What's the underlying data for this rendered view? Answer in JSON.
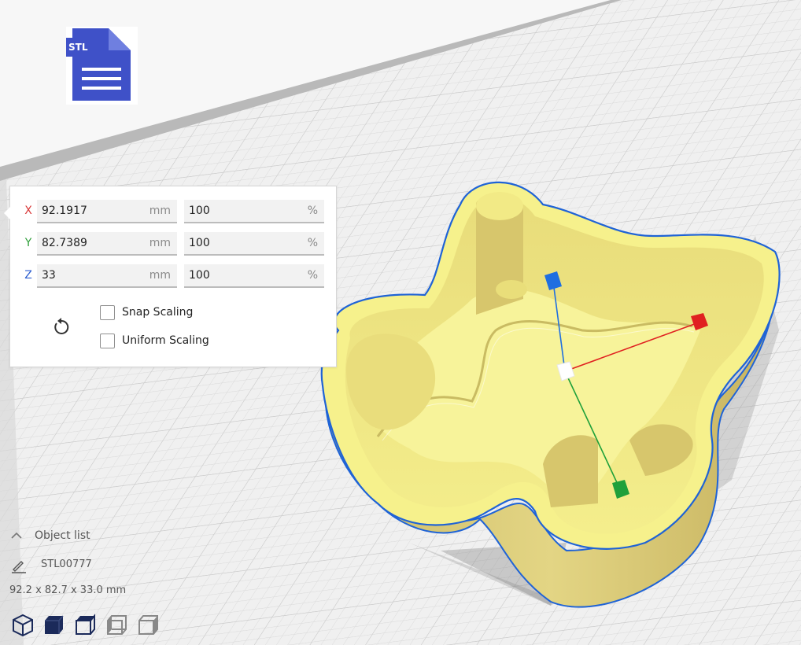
{
  "file_icon": {
    "icon": "stl-file-icon",
    "label": "STL",
    "color": "#3f51c8"
  },
  "scale_panel": {
    "x": {
      "label": "X",
      "color": "#d93a3a",
      "mm": "92.1917",
      "mm_unit": "mm",
      "percent": "100",
      "percent_unit": "%"
    },
    "y": {
      "label": "Y",
      "color": "#2f9e3a",
      "mm": "82.7389",
      "mm_unit": "mm",
      "percent": "100",
      "percent_unit": "%"
    },
    "z": {
      "label": "Z",
      "color": "#2f5fd0",
      "mm": "33",
      "mm_unit": "mm",
      "percent": "100",
      "percent_unit": "%"
    },
    "reset_icon": "reset-icon",
    "snap_scaling": {
      "label": "Snap Scaling",
      "checked": false
    },
    "uniform_scaling": {
      "label": "Uniform Scaling",
      "checked": false
    }
  },
  "object_list": {
    "label": "Object list",
    "icon": "chevron-up-icon"
  },
  "object": {
    "name": "STL00777",
    "icon": "pencil-icon"
  },
  "dimensions": "92.2 x 82.7 x 33.0 mm",
  "view_buttons": [
    "view-3d-icon",
    "view-front-icon",
    "view-top-icon",
    "view-left-icon",
    "view-right-icon"
  ],
  "colors": {
    "model_top": "#f5f08a",
    "model_side": "#d8c96f",
    "outline": "#1f63d6",
    "plate": "#f0f0f0",
    "grid": "#d2d2d2",
    "handle_x": "#e02020",
    "handle_y": "#1fa03a",
    "handle_z": "#1f6fe0"
  }
}
